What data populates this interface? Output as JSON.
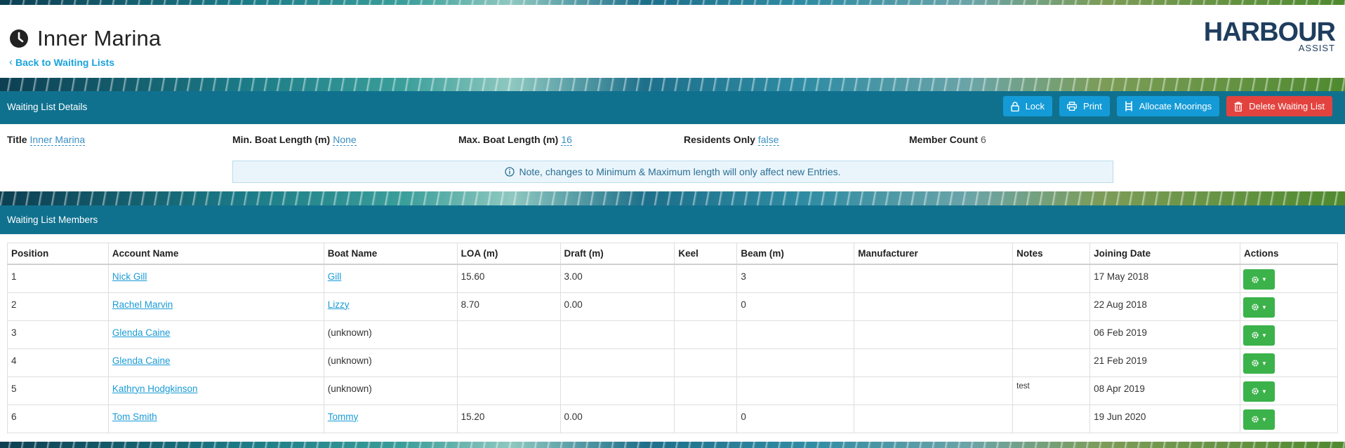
{
  "header": {
    "title": "Inner Marina",
    "back_link": "Back to Waiting Lists",
    "logo_main": "HARBOUR",
    "logo_sub": "ASSIST"
  },
  "details_panel": {
    "title": "Waiting List Details",
    "buttons": {
      "lock": "Lock",
      "print": "Print",
      "allocate": "Allocate Moorings",
      "delete": "Delete Waiting List"
    },
    "fields": {
      "title_label": "Title",
      "title_value": "Inner Marina",
      "min_label": "Min. Boat Length (m)",
      "min_value": "None",
      "max_label": "Max. Boat Length (m)",
      "max_value": "16",
      "residents_label": "Residents Only",
      "residents_value": "false",
      "count_label": "Member Count",
      "count_value": "6"
    },
    "note": "Note, changes to Minimum & Maximum length will only affect new Entries."
  },
  "members_panel": {
    "title": "Waiting List Members",
    "columns": [
      "Position",
      "Account Name",
      "Boat Name",
      "LOA (m)",
      "Draft (m)",
      "Keel",
      "Beam (m)",
      "Manufacturer",
      "Notes",
      "Joining Date",
      "Actions"
    ],
    "rows": [
      {
        "position": "1",
        "account": "Nick Gill",
        "boat": "Gill",
        "boat_link": true,
        "loa": "15.60",
        "draft": "3.00",
        "keel": "",
        "beam": "3",
        "manufacturer": "",
        "notes": "",
        "joined": "17 May 2018"
      },
      {
        "position": "2",
        "account": "Rachel Marvin",
        "boat": "Lizzy",
        "boat_link": true,
        "loa": "8.70",
        "draft": "0.00",
        "keel": "",
        "beam": "0",
        "manufacturer": "",
        "notes": "",
        "joined": "22 Aug 2018"
      },
      {
        "position": "3",
        "account": "Glenda Caine",
        "boat": "(unknown)",
        "boat_link": false,
        "loa": "",
        "draft": "",
        "keel": "",
        "beam": "",
        "manufacturer": "",
        "notes": "",
        "joined": "06 Feb 2019"
      },
      {
        "position": "4",
        "account": "Glenda Caine",
        "boat": "(unknown)",
        "boat_link": false,
        "loa": "",
        "draft": "",
        "keel": "",
        "beam": "",
        "manufacturer": "",
        "notes": "",
        "joined": "21 Feb 2019"
      },
      {
        "position": "5",
        "account": "Kathryn Hodgkinson",
        "boat": "(unknown)",
        "boat_link": false,
        "loa": "",
        "draft": "",
        "keel": "",
        "beam": "",
        "manufacturer": "",
        "notes": "test",
        "joined": "08 Apr 2019"
      },
      {
        "position": "6",
        "account": "Tom Smith",
        "boat": "Tommy",
        "boat_link": true,
        "loa": "15.20",
        "draft": "0.00",
        "keel": "",
        "beam": "0",
        "manufacturer": "",
        "notes": "",
        "joined": "19 Jun 2020"
      }
    ]
  },
  "colors": {
    "panel_bar": "#10718f",
    "link": "#1a9bd6",
    "button_blue": "#149bd7",
    "button_red": "#e3433f",
    "button_green": "#3bb24a"
  }
}
